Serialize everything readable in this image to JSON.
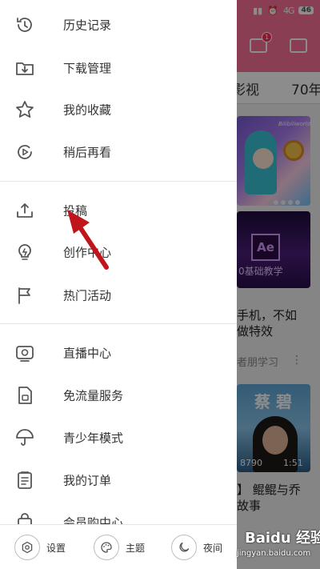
{
  "status_bar": {
    "network": "4G",
    "battery": "46"
  },
  "background": {
    "tabs": [
      "影视",
      "70年"
    ],
    "download_badge": "1",
    "card1_logo": "Bilibiliworld",
    "card2_logo": "Ae",
    "card2_thumb_text": "0基础教学",
    "card2_title_lines": [
      "手机，不如",
      "做特效"
    ],
    "card2_meta": "者朋学习",
    "card3_thumb_name": "蔡 碧",
    "card3_views": "8790",
    "card3_duration": "1:51",
    "card3_title_lines": [
      "】 鲲鲲与乔",
      "故事"
    ],
    "more_glyph": "⋮"
  },
  "drawer": {
    "group1": [
      {
        "icon": "history-clock-icon",
        "label": "历史记录"
      },
      {
        "icon": "download-folder-icon",
        "label": "下载管理"
      },
      {
        "icon": "star-icon",
        "label": "我的收藏"
      },
      {
        "icon": "watch-later-icon",
        "label": "稍后再看"
      }
    ],
    "group2": [
      {
        "icon": "upload-icon",
        "label": "投稿"
      },
      {
        "icon": "lightbulb-icon",
        "label": "创作中心"
      },
      {
        "icon": "flag-icon",
        "label": "热门活动"
      }
    ],
    "group3": [
      {
        "icon": "live-tv-icon",
        "label": "直播中心"
      },
      {
        "icon": "sim-card-icon",
        "label": "免流量服务"
      },
      {
        "icon": "umbrella-icon",
        "label": "青少年模式"
      },
      {
        "icon": "order-list-icon",
        "label": "我的订单"
      },
      {
        "icon": "shopping-bag-icon",
        "label": "会员购中心"
      }
    ],
    "footer": {
      "settings_label": "设置",
      "theme_label": "主题",
      "night_label": "夜间"
    }
  },
  "watermark": {
    "brand": "Baidu 经验",
    "url": "jingyan.baidu.com"
  },
  "colors": {
    "brand_pink": "#fb7299",
    "annotation_arrow": "#c0161b"
  }
}
